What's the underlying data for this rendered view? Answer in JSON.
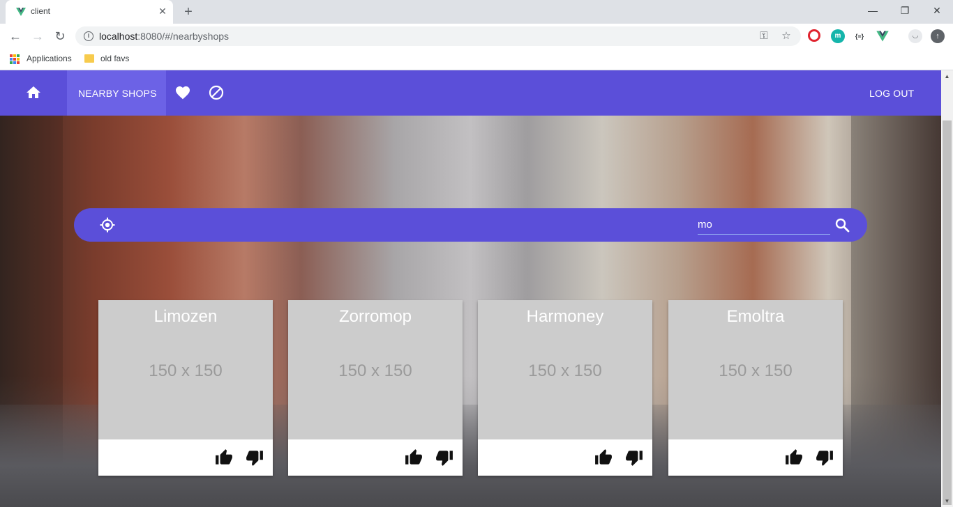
{
  "browser": {
    "tab_title": "client",
    "url_host": "localhost",
    "url_path": ":8080/#/nearbyshops",
    "bookmarks": [
      {
        "label": "Applications"
      },
      {
        "label": "old favs"
      }
    ]
  },
  "app": {
    "nav": {
      "nearby_shops_label": "NEARBY SHOPS",
      "logout_label": "LOG OUT"
    },
    "search": {
      "value": "mo"
    },
    "shops": [
      {
        "name": "Limozen",
        "placeholder": "150 x 150"
      },
      {
        "name": "Zorromop",
        "placeholder": "150 x 150"
      },
      {
        "name": "Harmoney",
        "placeholder": "150 x 150"
      },
      {
        "name": "Emoltra",
        "placeholder": "150 x 150"
      }
    ],
    "colors": {
      "primary": "#5b4fd9",
      "primary_active": "#6c62e6",
      "placeholder_bg": "#cccccc"
    }
  }
}
